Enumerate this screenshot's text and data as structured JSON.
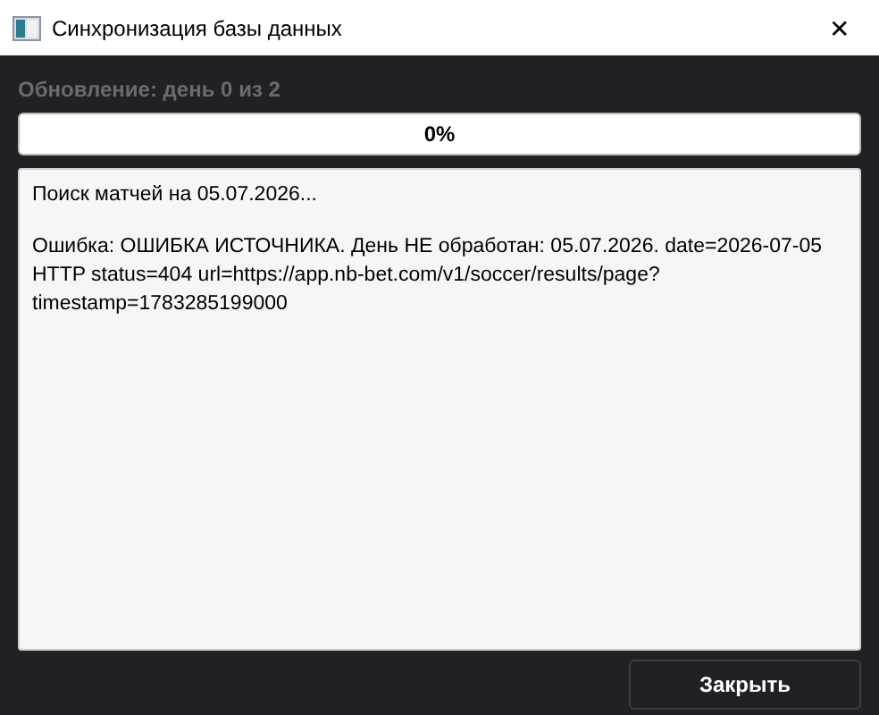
{
  "window": {
    "title": "Синхронизация базы данных",
    "close": "✕"
  },
  "status": {
    "text": "Обновление: день 0 из 2",
    "disabled": true
  },
  "progress": {
    "level": 0,
    "reading": "0%"
  },
  "log": {
    "paragraphs": [
      [
        "Поиск матчей на 05.07.2026..."
      ],
      [
        "Ошибка: ОШИБКА ИСТОЧНИКА. День НЕ обработан: 05.07.2026. date=2026-07-05",
        "HTTP status=404 url=https://app.nb-bet.com/v1/soccer/results/page?",
        "timestamp=1783285199000"
      ]
    ]
  },
  "buttons": [
    {
      "label": "Закрыть"
    }
  ]
}
